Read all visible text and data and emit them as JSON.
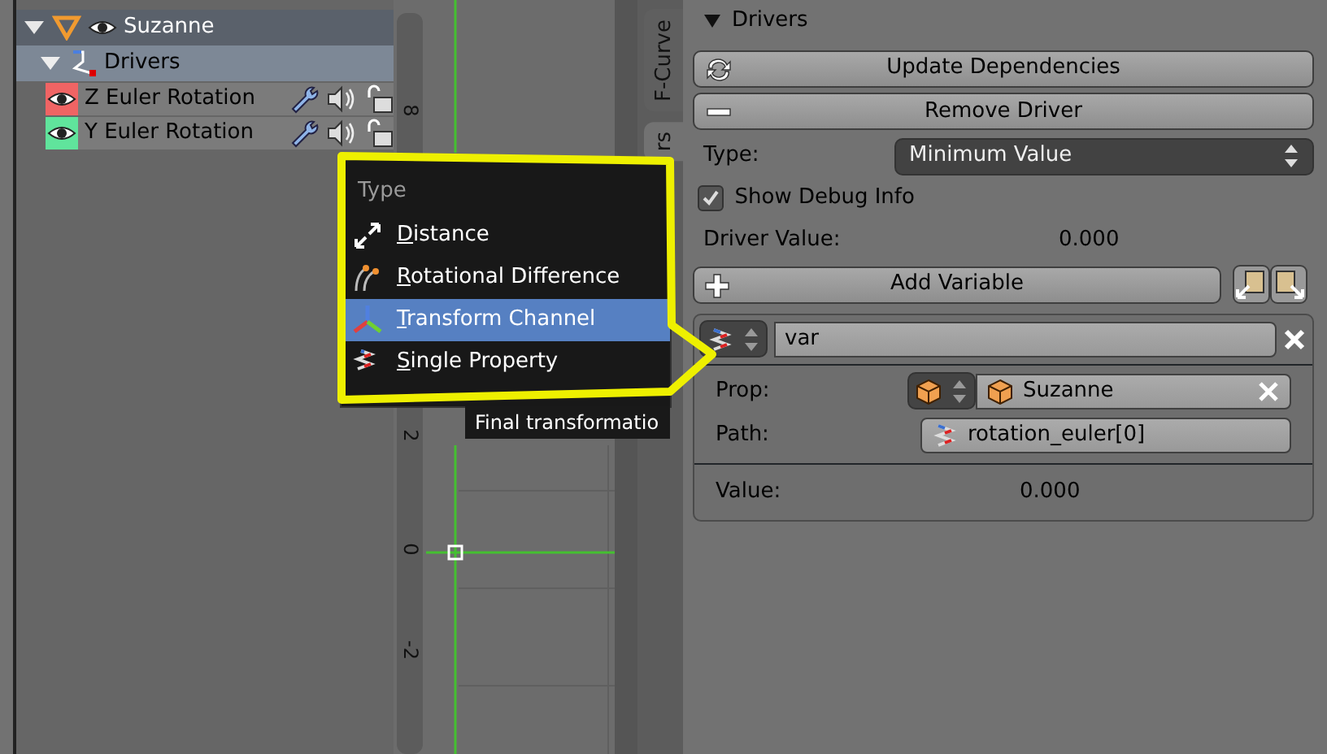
{
  "outliner": {
    "rows": [
      {
        "kind": "object",
        "label": "Suzanne",
        "expanded": true
      },
      {
        "kind": "drivers",
        "label": "Drivers",
        "expanded": true
      },
      {
        "kind": "channel",
        "label": "Z Euler Rotation",
        "color": "#f06464"
      },
      {
        "kind": "channel",
        "label": "Y Euler Rotation",
        "color": "#60e49c"
      }
    ]
  },
  "graph": {
    "ruler_labels": [
      "8",
      "2",
      "0",
      "-2"
    ]
  },
  "side_tabs": [
    {
      "label": "F-Curve",
      "selected": false
    },
    {
      "label": "rs",
      "selected": true
    }
  ],
  "panel": {
    "title": "Drivers",
    "expanded": true,
    "buttons": [
      {
        "kind": "refresh",
        "label": "Update Dependencies"
      },
      {
        "kind": "minus",
        "label": "Remove Driver"
      }
    ],
    "type": {
      "label": "Type:",
      "value": "Minimum Value"
    },
    "debug": {
      "label": "Show Debug Info",
      "checked": true
    },
    "driver_value": {
      "label": "Driver Value:",
      "value": "0.000"
    },
    "add_variable": {
      "label": "Add Variable"
    },
    "variable": {
      "name": "var",
      "prop_label": "Prop:",
      "prop_value": "Suzanne",
      "path_label": "Path:",
      "path_value": "rotation_euler[0]",
      "value_label": "Value:",
      "value": "0.000"
    }
  },
  "menu": {
    "title": "Type",
    "items": [
      {
        "kind": "distance",
        "label": "Distance",
        "selected": false
      },
      {
        "kind": "rotation",
        "label": "Rotational Difference",
        "selected": false
      },
      {
        "kind": "transform",
        "label": "Transform Channel",
        "selected": true
      },
      {
        "kind": "single",
        "label": "Single Property",
        "selected": false
      }
    ]
  },
  "tooltip": {
    "text": "Final transformatio"
  }
}
